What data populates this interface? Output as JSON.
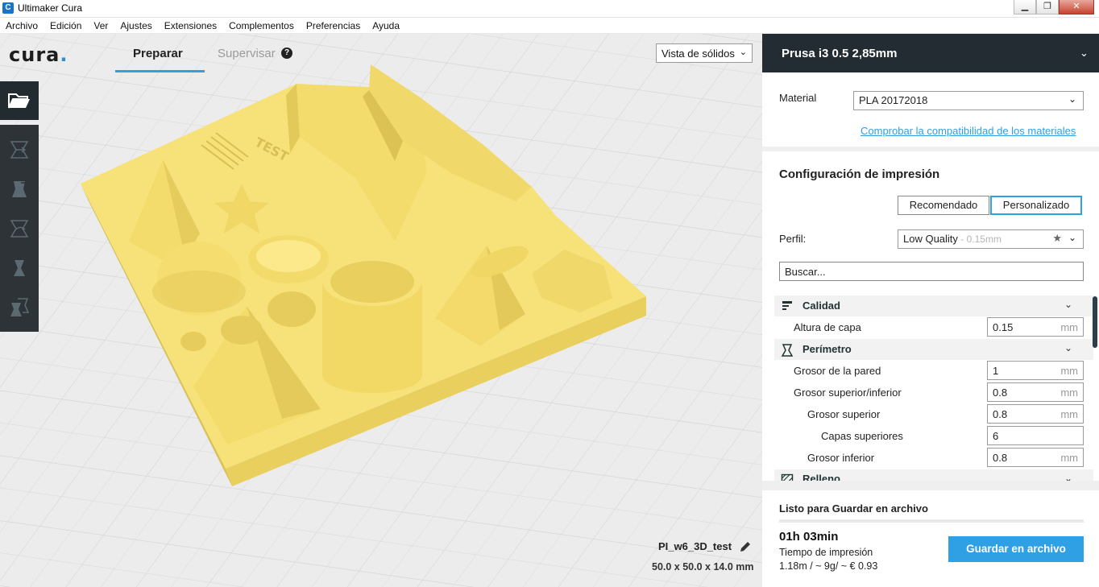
{
  "window": {
    "title": "Ultimaker Cura",
    "minimize": "▁",
    "maximize": "❐",
    "close": "✕"
  },
  "menu": [
    "Archivo",
    "Edición",
    "Ver",
    "Ajustes",
    "Extensiones",
    "Complementos",
    "Preferencias",
    "Ayuda"
  ],
  "header": {
    "logo": "cura",
    "logo_dot": ".",
    "tab_prepare": "Preparar",
    "tab_monitor": "Supervisar",
    "help": "?",
    "view_mode": "Vista de sólidos"
  },
  "toolbar": {
    "open": "folder-open-icon",
    "tools": [
      "move-icon",
      "scale-icon",
      "rotate-icon",
      "mirror-icon",
      "per-model-settings-icon"
    ]
  },
  "model": {
    "name": "PI_w6_3D_test",
    "dimensions": "50.0 x 50.0 x 14.0 mm",
    "color": "#f7e27a"
  },
  "panel": {
    "printer": "Prusa i3 0.5 2,85mm",
    "material_label": "Material",
    "material_value": "PLA 20172018",
    "compat_link": "Comprobar la compatibilidad de los materiales",
    "settings_title": "Configuración de impresión",
    "mode_recommended": "Recomendado",
    "mode_custom": "Personalizado",
    "profile_label": "Perfil:",
    "profile_value": "Low Quality",
    "profile_sub": " - 0.15mm",
    "search_placeholder": "Buscar...",
    "categories": {
      "quality": "Calidad",
      "shell": "Perímetro",
      "infill": "Relleno"
    },
    "settings": {
      "layer_height": {
        "label": "Altura de capa",
        "value": "0.15",
        "unit": "mm"
      },
      "wall_thickness": {
        "label": "Grosor de la pared",
        "value": "1",
        "unit": "mm"
      },
      "top_bottom": {
        "label": "Grosor superior/inferior",
        "value": "0.8",
        "unit": "mm"
      },
      "top_thickness": {
        "label": "Grosor superior",
        "value": "0.8",
        "unit": "mm"
      },
      "top_layers": {
        "label": "Capas superiores",
        "value": "6"
      },
      "bottom_thickness": {
        "label": "Grosor inferior",
        "value": "0.8",
        "unit": "mm"
      }
    },
    "ready_title": "Listo para Guardar en archivo",
    "print_time": "01h 03min",
    "print_time_label": "Tiempo de impresión",
    "print_stats": "1.18m / ~ 9g/ ~ € 0.93",
    "save_button": "Guardar en archivo",
    "accent": "#2ea0e3"
  }
}
